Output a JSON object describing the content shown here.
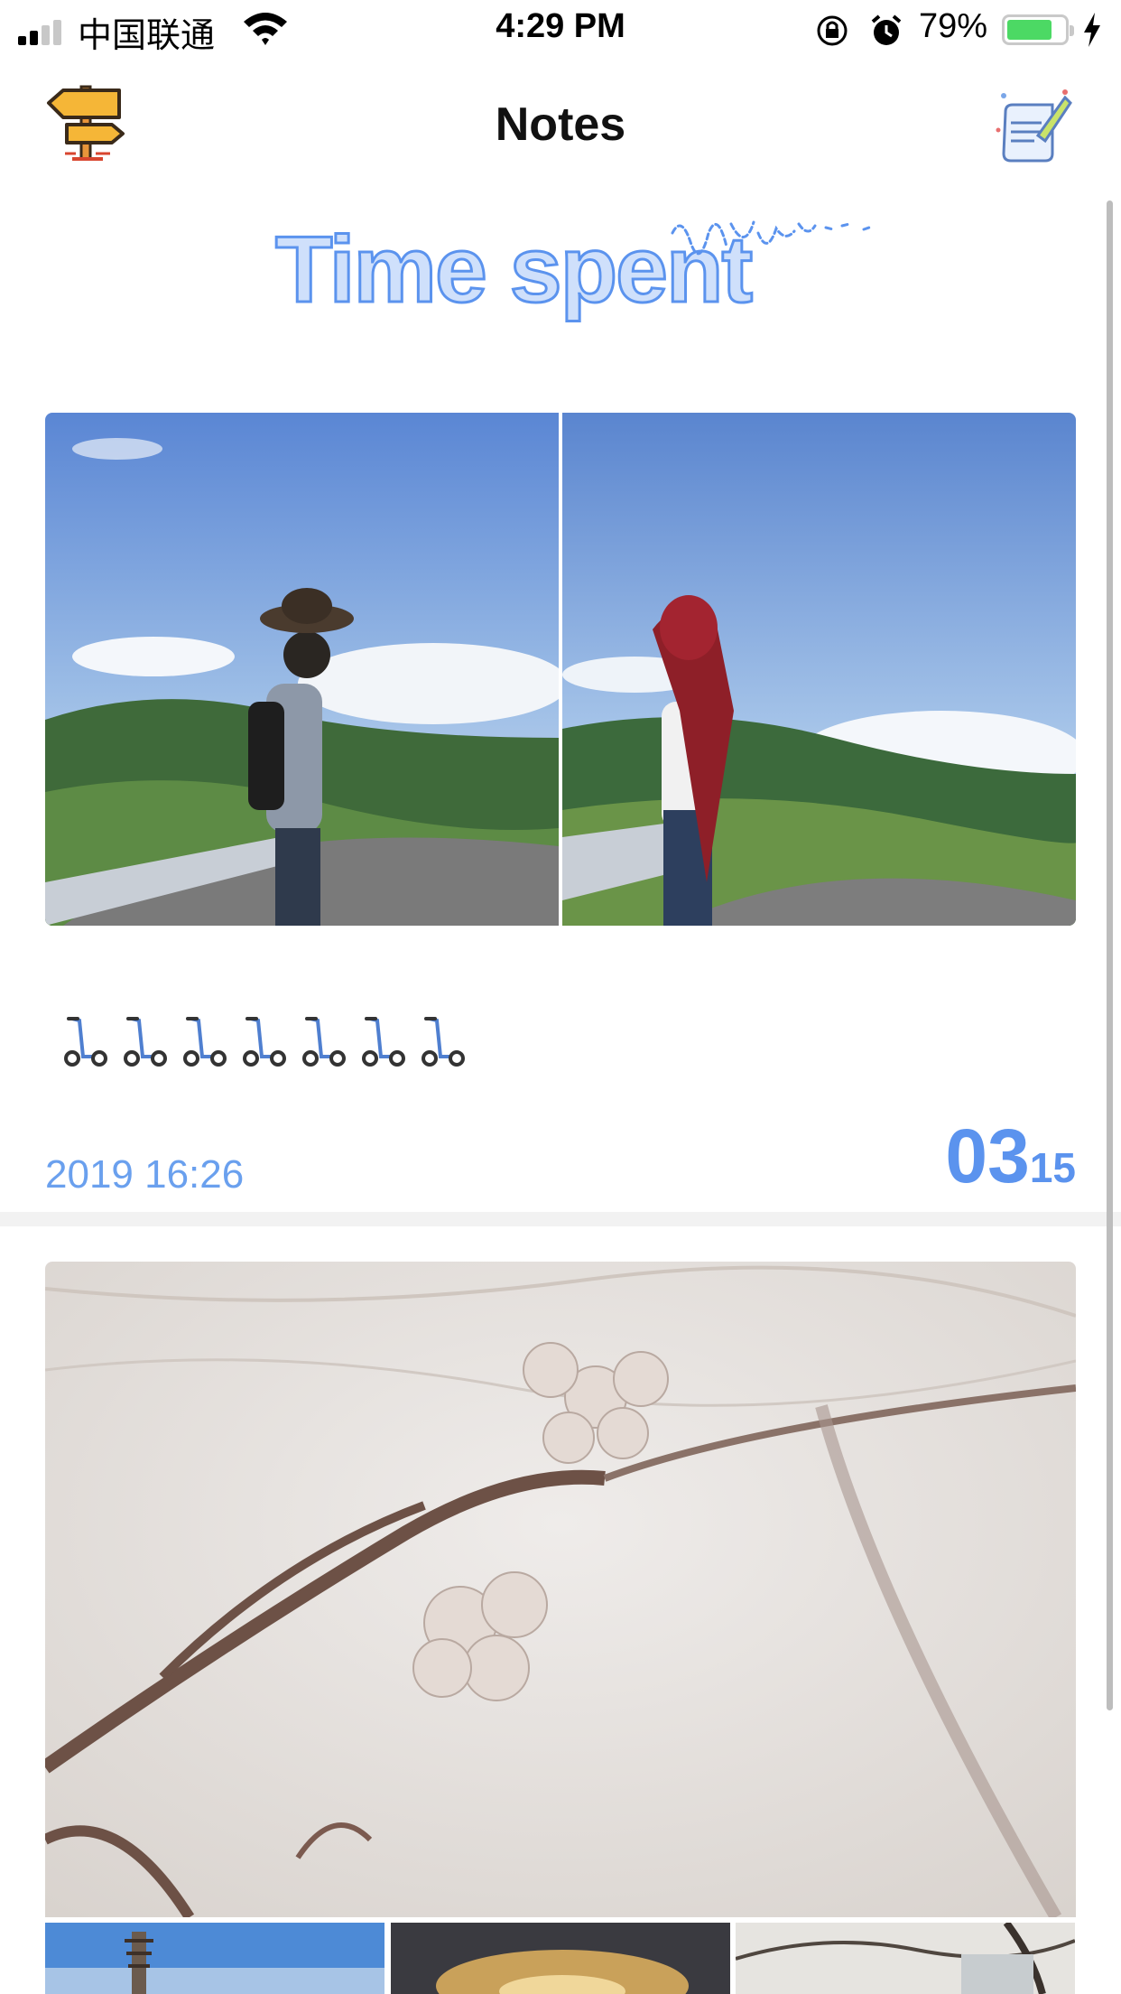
{
  "status_bar": {
    "carrier": "中国联通",
    "time": "4:29 PM",
    "battery_percent": "79%",
    "battery_level": 0.79,
    "battery_color": "#4cd964"
  },
  "nav": {
    "title": "Notes",
    "left_icon": "signpost-icon",
    "right_icon": "compose-scroll-icon"
  },
  "note_1": {
    "handwritten_text": "Time spent",
    "photos": [
      "photo-man-hat",
      "photo-woman-scarf"
    ],
    "emoji_icon": "scooter-icon",
    "emoji_count": 7,
    "date": "2019 16:26",
    "day": "03",
    "month": "15"
  },
  "note_2": {
    "photos": [
      "photo-cherry-blossom",
      "photo-pagoda",
      "photo-sunset-sky",
      "photo-tree-branches"
    ]
  },
  "accent_color": "#5b93ee"
}
